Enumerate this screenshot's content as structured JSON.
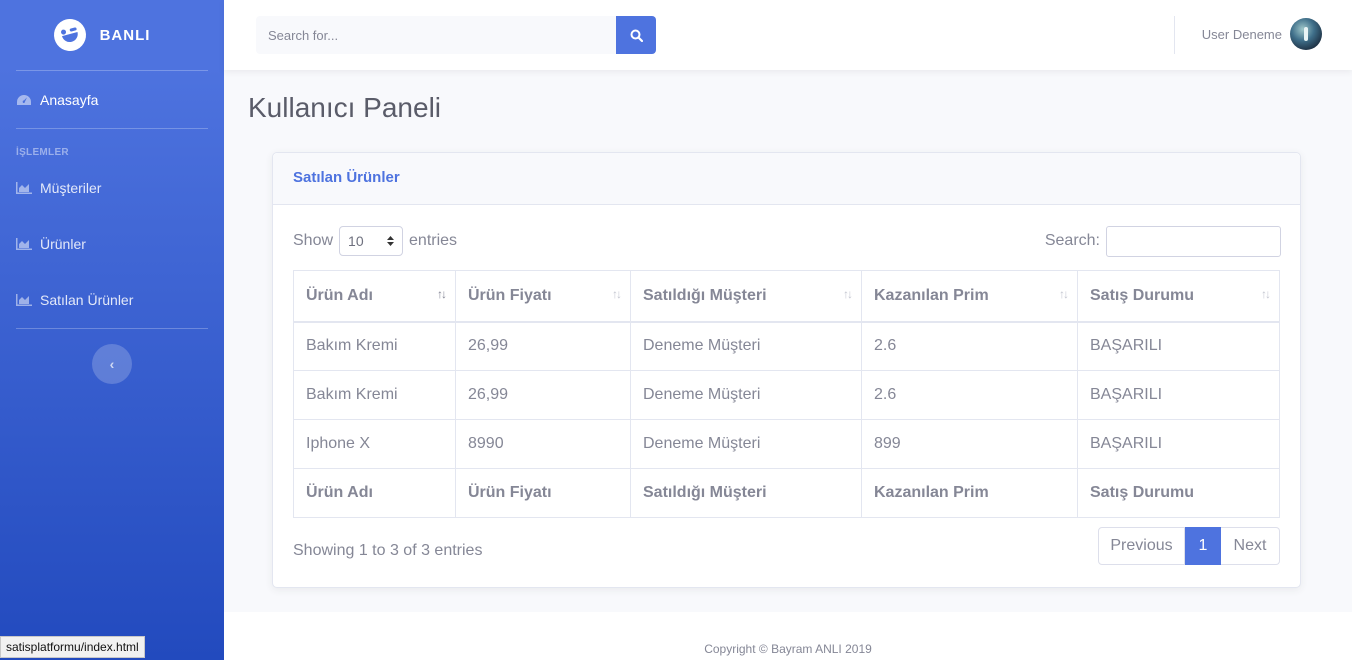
{
  "sidebar": {
    "brand": "BANLI",
    "items": [
      {
        "label": "Anasayfa",
        "icon": "gauge-icon"
      },
      {
        "label": "Müşteriler",
        "icon": "chart-area-icon"
      },
      {
        "label": "Ürünler",
        "icon": "chart-area-icon"
      },
      {
        "label": "Satılan Ürünler",
        "icon": "chart-area-icon"
      }
    ],
    "heading": "İŞLEMLER",
    "toggle_icon": "‹"
  },
  "topbar": {
    "search_placeholder": "Search for...",
    "user_name": "User Deneme"
  },
  "page_title": "Kullanıcı Paneli",
  "card": {
    "title": "Satılan Ürünler",
    "show_label": "Show",
    "entries_label": "entries",
    "page_length": "10",
    "search_label": "Search:",
    "columns": [
      "Ürün Adı",
      "Ürün Fiyatı",
      "Satıldığı Müşteri",
      "Kazanılan Prim",
      "Satış Durumu"
    ],
    "rows": [
      [
        "Bakım Kremi",
        "26,99",
        "Deneme Müşteri",
        "2.6",
        "BAŞARILI"
      ],
      [
        "Bakım Kremi",
        "26,99",
        "Deneme Müşteri",
        "2.6",
        "BAŞARILI"
      ],
      [
        "Iphone X",
        "8990",
        "Deneme Müşteri",
        "899",
        "BAŞARILI"
      ]
    ],
    "info": "Showing 1 to 3 of 3 entries",
    "pagination": {
      "previous": "Previous",
      "current": "1",
      "next": "Next"
    }
  },
  "footer": "Copyright © Bayram ANLI 2019",
  "status_url": "satisplatformu/index.html",
  "colors": {
    "primary": "#4e73df",
    "text": "#858796",
    "border": "#e3e6f0"
  }
}
